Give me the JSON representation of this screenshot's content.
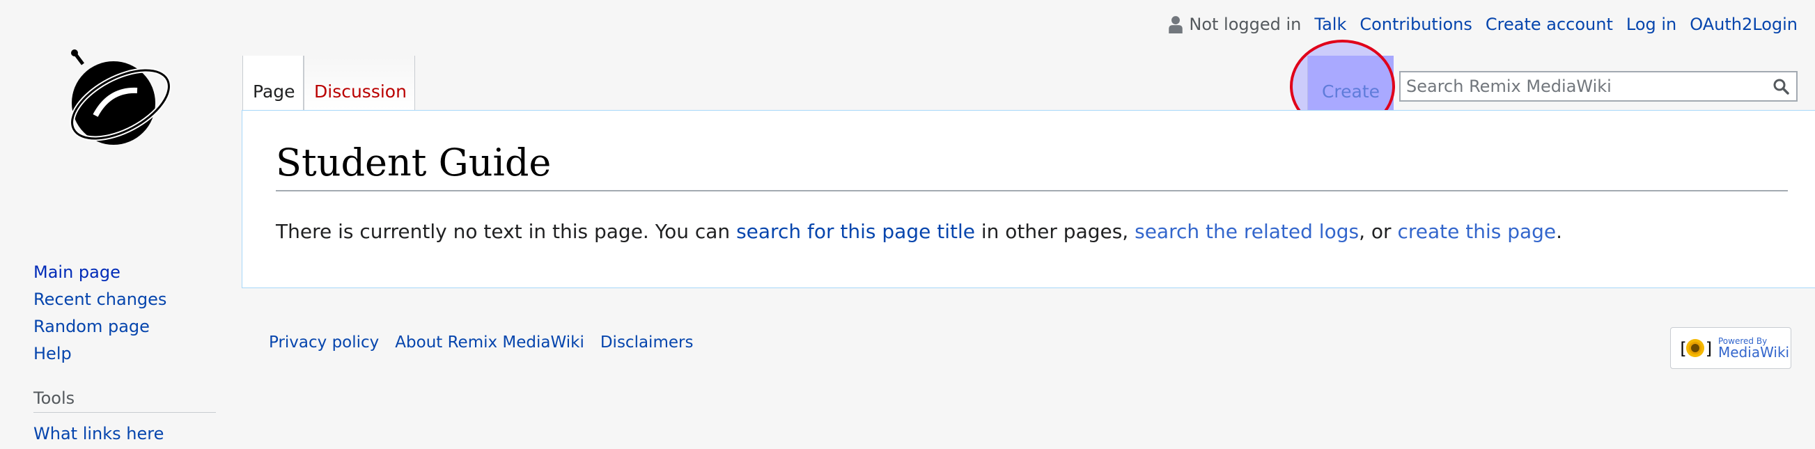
{
  "personal_tools": {
    "anon_label": "Not logged in",
    "talk": "Talk",
    "contributions": "Contributions",
    "create_account": "Create account",
    "log_in": "Log in",
    "oauth_login": "OAuth2Login"
  },
  "tabs": {
    "page": "Page",
    "discussion": "Discussion",
    "create": "Create"
  },
  "search": {
    "placeholder": "Search Remix MediaWiki"
  },
  "content": {
    "title": "Student Guide",
    "text_1": "There is currently no text in this page. You can ",
    "link_search": "search for this page title",
    "text_2": " in other pages, ",
    "link_logs": "search the related logs",
    "text_3": ", or ",
    "link_create": "create this page",
    "text_4": "."
  },
  "sidebar": {
    "items": [
      "Main page",
      "Recent changes",
      "Random page",
      "Help"
    ],
    "tools_heading": "Tools",
    "tools_items": [
      "What links here"
    ]
  },
  "footer": {
    "links": [
      "Privacy policy",
      "About Remix MediaWiki",
      "Disclaimers"
    ],
    "powered_small": "Powered By",
    "powered_big": "MediaWiki"
  },
  "colors": {
    "link": "#0645ad",
    "new_link": "#ba0000",
    "highlight_ring": "#e0001a",
    "highlight_fill": "#aaaaff"
  },
  "icons": [
    "user-icon",
    "search-icon",
    "logo-icon",
    "mediawiki-flower-icon"
  ]
}
